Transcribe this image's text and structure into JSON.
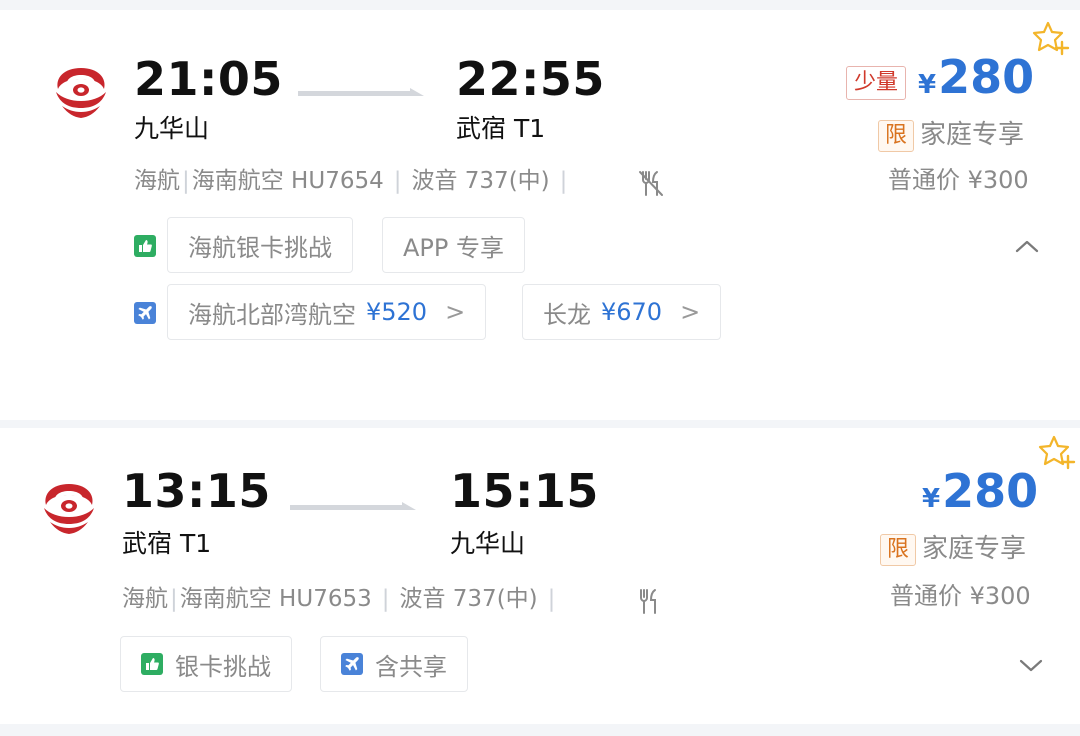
{
  "flights": [
    {
      "dep_time": "21:05",
      "dep_airport": "九华山",
      "arr_time": "22:55",
      "arr_airport": "武宿 T1",
      "airline_short": "海航",
      "airline": "海南航空 HU7654",
      "aircraft": "波音 737(中)",
      "meal_icon": "no-meal-icon",
      "scarce_label": "少量",
      "currency": "¥",
      "price": "280",
      "limit_label": "限",
      "family_label": "家庭专享",
      "normal_price": "普通价 ¥300",
      "tags": [
        "海航银卡挑战",
        "APP 专享"
      ],
      "transfers": [
        {
          "airline": "海航北部湾航空",
          "price": "¥520"
        },
        {
          "airline": "长龙",
          "price": "¥670"
        }
      ],
      "expand_icon": "chevron-up-icon"
    },
    {
      "dep_time": "13:15",
      "dep_airport": "武宿 T1",
      "arr_time": "15:15",
      "arr_airport": "九华山",
      "airline_short": "海航",
      "airline": "海南航空 HU7653",
      "aircraft": "波音 737(中)",
      "meal_icon": "meal-icon",
      "currency": "¥",
      "price": "280",
      "limit_label": "限",
      "family_label": "家庭专享",
      "normal_price": "普通价 ¥300",
      "tags": [
        "银卡挑战",
        "含共享"
      ],
      "expand_icon": "chevron-down-icon"
    }
  ],
  "colors": {
    "price_blue": "#2e73d4",
    "logo_red": "#c8262c",
    "star_gold": "#f3b52a",
    "scarce_red": "#d0392b"
  }
}
